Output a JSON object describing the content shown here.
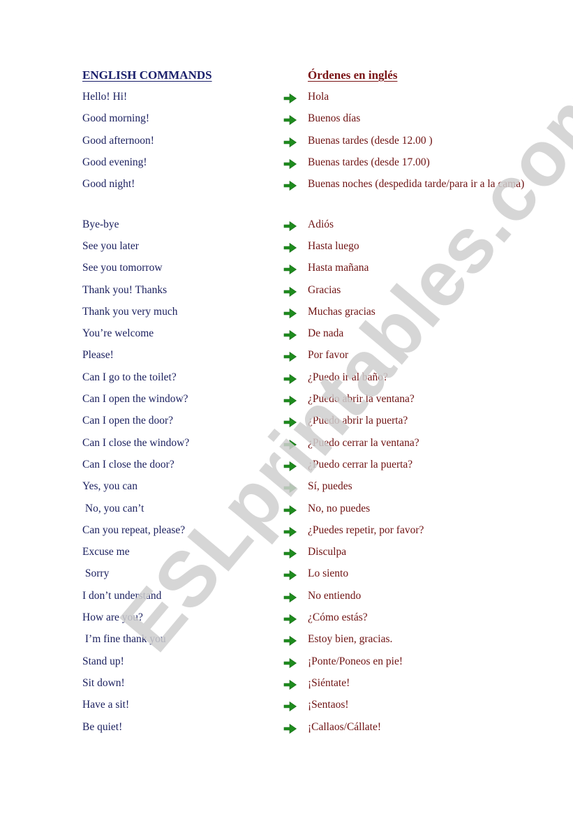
{
  "headings": {
    "english": "ENGLISH COMMANDS",
    "spanish": "Órdenes en inglés"
  },
  "colors": {
    "english_text": "#1a1f5e",
    "spanish_text": "#6e1212",
    "arrow": "#1e8c1e",
    "watermark": "#cfcfcf"
  },
  "arrow_icon": "green-right-arrow-icon",
  "watermark": "ESLprintables.com",
  "rows": [
    {
      "en": "Hello! Hi!",
      "es": "Hola"
    },
    {
      "en": "Good morning!",
      "es": "Buenos días"
    },
    {
      "en": "Good afternoon!",
      "es": "Buenas tardes (desde 12.00 )"
    },
    {
      "en": "Good evening!",
      "es": "Buenas tardes (desde 17.00)"
    },
    {
      "en": "Good night!",
      "es": "Buenas noches (despedida tarde/para ir a la cama)"
    },
    {
      "en": "Bye-bye",
      "es": "Adiós"
    },
    {
      "en": "See you later",
      "es": "Hasta luego"
    },
    {
      "en": "See you tomorrow",
      "es": "Hasta mañana"
    },
    {
      "en": "Thank you! Thanks",
      "es": "Gracias"
    },
    {
      "en": "Thank you very much",
      "es": "Muchas gracias"
    },
    {
      "en": "You’re welcome",
      "es": "De nada"
    },
    {
      "en": "Please!",
      "es": "Por favor"
    },
    {
      "en": "Can I go to the toilet?",
      "es": "¿Puedo ir al baño?"
    },
    {
      "en": "Can I open the window?",
      "es": "¿Puedo abrir la ventana?"
    },
    {
      "en": "Can I open the door?",
      "es": "¿Puedo abrir la puerta?"
    },
    {
      "en": "Can I close the window?",
      "es": "¿Puedo cerrar la ventana?"
    },
    {
      "en": "Can I close the door?",
      "es": "¿Puedo cerrar la puerta?"
    },
    {
      "en": "Yes, you can",
      "es": "Sí, puedes"
    },
    {
      "en": " No, you can’t",
      "es": "No, no puedes"
    },
    {
      "en": "Can you repeat, please?",
      "es": "¿Puedes repetir, por favor?"
    },
    {
      "en": "Excuse me",
      "es": "Disculpa"
    },
    {
      "en": " Sorry",
      "es": "Lo siento"
    },
    {
      "en": "I don’t understand",
      "es": "No entiendo"
    },
    {
      "en": "How are you?",
      "es": "¿Cómo estás?"
    },
    {
      "en": " I’m fine thank you",
      "es": "Estoy bien, gracias."
    },
    {
      "en": "Stand up!",
      "es": "¡Ponte/Poneos en pie!"
    },
    {
      "en": "Sit down!",
      "es": "¡Siéntate!"
    },
    {
      "en": "Have a sit!",
      "es": "¡Sentaos!"
    },
    {
      "en": "Be quiet!",
      "es": "¡Callaos/Cállate!"
    }
  ]
}
